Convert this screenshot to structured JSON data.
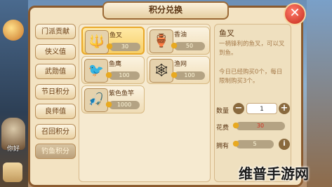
{
  "window": {
    "title": "积分兑换",
    "close_label": "✕"
  },
  "tabs": [
    {
      "label": "门派贡献",
      "active": false
    },
    {
      "label": "侠义值",
      "active": false
    },
    {
      "label": "武勋值",
      "active": false
    },
    {
      "label": "节日积分",
      "active": false
    },
    {
      "label": "良师值",
      "active": false
    },
    {
      "label": "召回积分",
      "active": false
    },
    {
      "label": "钓鱼积分",
      "active": true
    }
  ],
  "items": [
    {
      "name": "鱼叉",
      "price": "30",
      "icon": "harpoon-icon",
      "glyph": "🔱",
      "selected": true
    },
    {
      "name": "香油",
      "price": "50",
      "icon": "oil-bottle-icon",
      "glyph": "🏺",
      "selected": false
    },
    {
      "name": "鱼鹰",
      "price": "100",
      "icon": "cormorant-icon",
      "glyph": "🐦",
      "selected": false
    },
    {
      "name": "渔网",
      "price": "100",
      "icon": "fishing-net-icon",
      "glyph": "🕸",
      "selected": false
    },
    {
      "name": "紫色鱼竿",
      "price": "1000",
      "icon": "fishing-rod-icon",
      "glyph": "🎣",
      "selected": false
    }
  ],
  "detail": {
    "name": "鱼叉",
    "description": "一柄锋利的鱼叉，可以叉到鱼。",
    "limit_text": "今日已经购买0个，每日限制购买3个。",
    "quantity_label": "数量",
    "quantity_value": "1",
    "minus_label": "−",
    "plus_label": "+",
    "cost_label": "花费",
    "cost_value": "30",
    "own_label": "拥有",
    "own_value": "5",
    "info_label": "i"
  },
  "background": {
    "character_label": "你好"
  },
  "watermark": "维普手游网",
  "colors": {
    "accent": "#e9a92b",
    "cost_text": "#d62b1b",
    "panel": "#f3e3c2"
  }
}
